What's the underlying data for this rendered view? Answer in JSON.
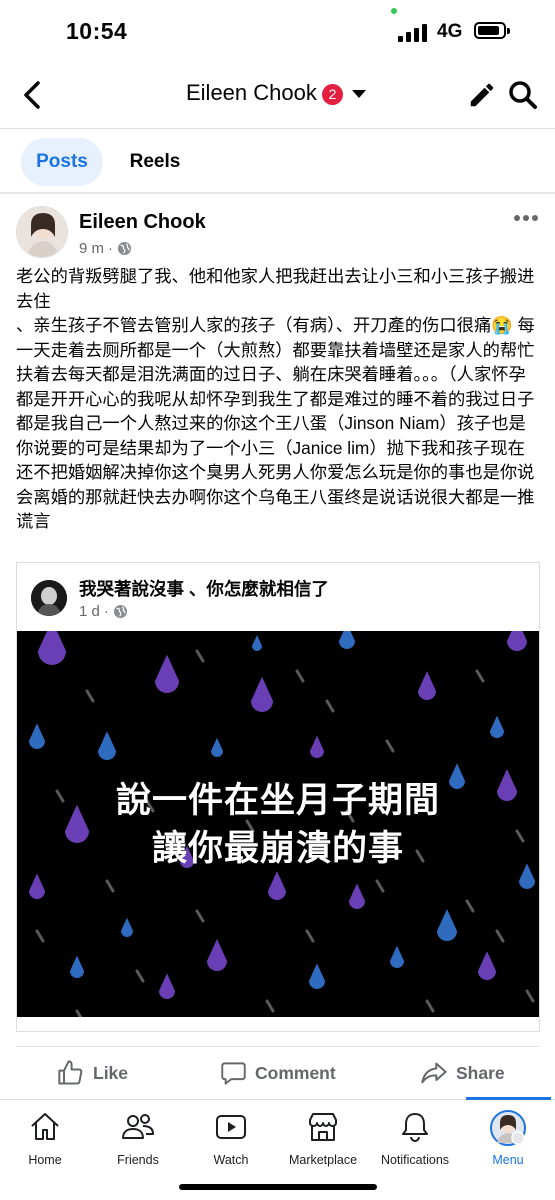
{
  "status_bar": {
    "time": "10:54",
    "network": "4G"
  },
  "header": {
    "title": "Eileen Chook",
    "badge_count": "2"
  },
  "tabs": [
    {
      "label": "Posts",
      "active": true
    },
    {
      "label": "Reels",
      "active": false
    }
  ],
  "post": {
    "author": "Eileen Chook",
    "time": "9 m",
    "separator": "·",
    "text": "老公的背叛劈腿了我、他和他家人把我赶出去让小三和小三孩子搬进去住\n、亲生孩子不管去管别人家的孩子（有病）、开刀產的伤口很痛😭 每一天走着去厕所都是一个（大煎熬）都要靠扶着墙壁还是家人的帮忙扶着去每天都是泪洗满面的过日子、躺在床哭着睡着。。。（人家怀孕都是开开心心的我呢从却怀孕到我生了都是难过的睡不着的我过日子都是我自己一个人熬过来的你这个王八蛋（Jinson Niam）孩子也是你说要的可是结果却为了一个小三（Janice lim）抛下我和孩子现在还不把婚姻解决掉你这个臭男人死男人你爱怎么玩是你的事也是你说会离婚的那就赶快去办啊你这个乌龟王八蛋终是说话说很大都是一推谎言"
  },
  "shared_post": {
    "title": "我哭著說沒事 、你怎麼就相信了",
    "time": "1 d",
    "separator": "·",
    "image_text_line1": "說一件在坐月子期間",
    "image_text_line2": "讓你最崩潰的事"
  },
  "actions": {
    "like": "Like",
    "comment": "Comment",
    "share": "Share"
  },
  "bottom_nav": [
    {
      "label": "Home",
      "icon": "home-icon",
      "active": false
    },
    {
      "label": "Friends",
      "icon": "friends-icon",
      "active": false
    },
    {
      "label": "Watch",
      "icon": "watch-icon",
      "active": false
    },
    {
      "label": "Marketplace",
      "icon": "marketplace-icon",
      "active": false
    },
    {
      "label": "Notifications",
      "icon": "bell-icon",
      "active": false
    },
    {
      "label": "Menu",
      "icon": "menu-avatar",
      "active": true
    }
  ],
  "colors": {
    "accent": "#1b74e4",
    "badge": "#e41e3f",
    "secondary_text": "#65676b",
    "rain_purple": "#6a3fb5",
    "rain_blue": "#2f6bbf"
  }
}
